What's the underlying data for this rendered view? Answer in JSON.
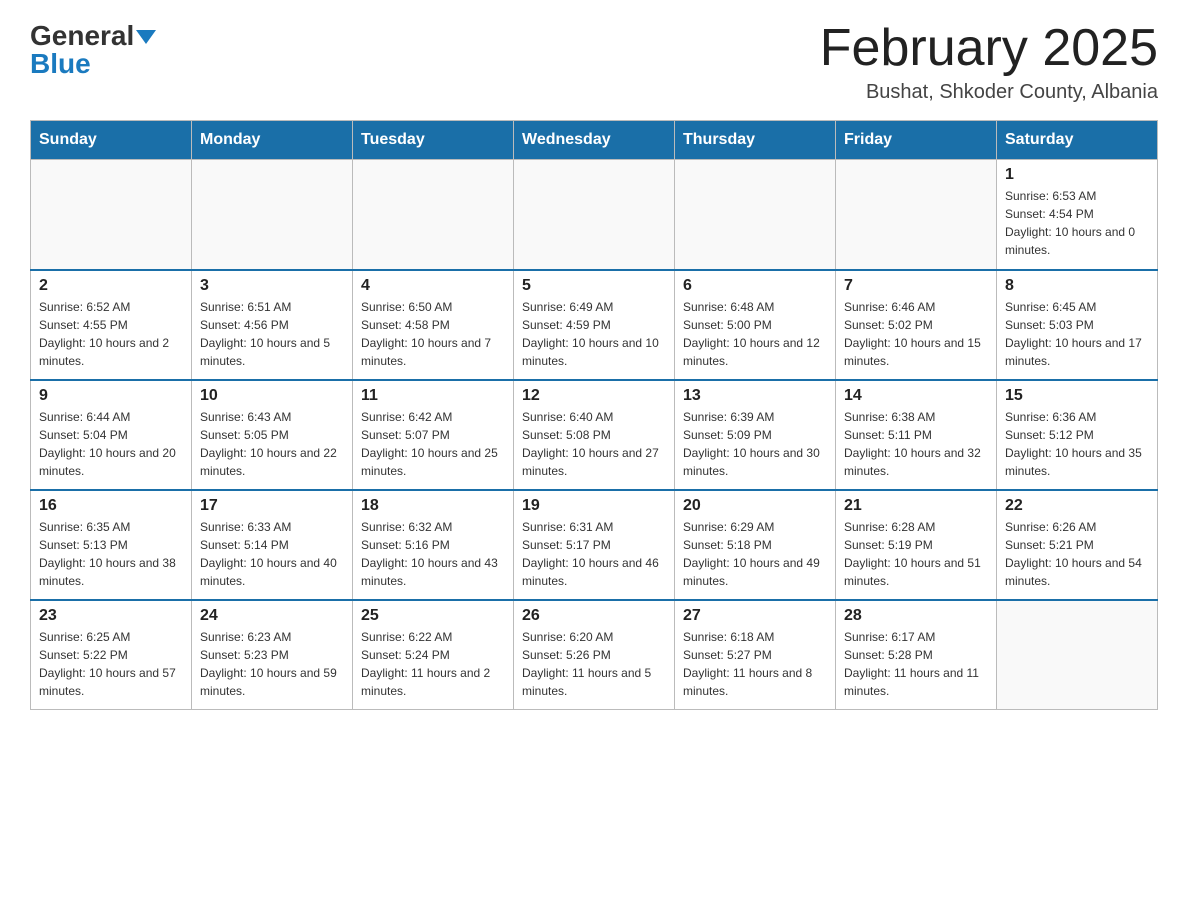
{
  "header": {
    "logo_general": "General",
    "logo_blue": "Blue",
    "month_title": "February 2025",
    "subtitle": "Bushat, Shkoder County, Albania"
  },
  "days_of_week": [
    "Sunday",
    "Monday",
    "Tuesday",
    "Wednesday",
    "Thursday",
    "Friday",
    "Saturday"
  ],
  "weeks": [
    [
      {
        "day": "",
        "info": ""
      },
      {
        "day": "",
        "info": ""
      },
      {
        "day": "",
        "info": ""
      },
      {
        "day": "",
        "info": ""
      },
      {
        "day": "",
        "info": ""
      },
      {
        "day": "",
        "info": ""
      },
      {
        "day": "1",
        "info": "Sunrise: 6:53 AM\nSunset: 4:54 PM\nDaylight: 10 hours and 0 minutes."
      }
    ],
    [
      {
        "day": "2",
        "info": "Sunrise: 6:52 AM\nSunset: 4:55 PM\nDaylight: 10 hours and 2 minutes."
      },
      {
        "day": "3",
        "info": "Sunrise: 6:51 AM\nSunset: 4:56 PM\nDaylight: 10 hours and 5 minutes."
      },
      {
        "day": "4",
        "info": "Sunrise: 6:50 AM\nSunset: 4:58 PM\nDaylight: 10 hours and 7 minutes."
      },
      {
        "day": "5",
        "info": "Sunrise: 6:49 AM\nSunset: 4:59 PM\nDaylight: 10 hours and 10 minutes."
      },
      {
        "day": "6",
        "info": "Sunrise: 6:48 AM\nSunset: 5:00 PM\nDaylight: 10 hours and 12 minutes."
      },
      {
        "day": "7",
        "info": "Sunrise: 6:46 AM\nSunset: 5:02 PM\nDaylight: 10 hours and 15 minutes."
      },
      {
        "day": "8",
        "info": "Sunrise: 6:45 AM\nSunset: 5:03 PM\nDaylight: 10 hours and 17 minutes."
      }
    ],
    [
      {
        "day": "9",
        "info": "Sunrise: 6:44 AM\nSunset: 5:04 PM\nDaylight: 10 hours and 20 minutes."
      },
      {
        "day": "10",
        "info": "Sunrise: 6:43 AM\nSunset: 5:05 PM\nDaylight: 10 hours and 22 minutes."
      },
      {
        "day": "11",
        "info": "Sunrise: 6:42 AM\nSunset: 5:07 PM\nDaylight: 10 hours and 25 minutes."
      },
      {
        "day": "12",
        "info": "Sunrise: 6:40 AM\nSunset: 5:08 PM\nDaylight: 10 hours and 27 minutes."
      },
      {
        "day": "13",
        "info": "Sunrise: 6:39 AM\nSunset: 5:09 PM\nDaylight: 10 hours and 30 minutes."
      },
      {
        "day": "14",
        "info": "Sunrise: 6:38 AM\nSunset: 5:11 PM\nDaylight: 10 hours and 32 minutes."
      },
      {
        "day": "15",
        "info": "Sunrise: 6:36 AM\nSunset: 5:12 PM\nDaylight: 10 hours and 35 minutes."
      }
    ],
    [
      {
        "day": "16",
        "info": "Sunrise: 6:35 AM\nSunset: 5:13 PM\nDaylight: 10 hours and 38 minutes."
      },
      {
        "day": "17",
        "info": "Sunrise: 6:33 AM\nSunset: 5:14 PM\nDaylight: 10 hours and 40 minutes."
      },
      {
        "day": "18",
        "info": "Sunrise: 6:32 AM\nSunset: 5:16 PM\nDaylight: 10 hours and 43 minutes."
      },
      {
        "day": "19",
        "info": "Sunrise: 6:31 AM\nSunset: 5:17 PM\nDaylight: 10 hours and 46 minutes."
      },
      {
        "day": "20",
        "info": "Sunrise: 6:29 AM\nSunset: 5:18 PM\nDaylight: 10 hours and 49 minutes."
      },
      {
        "day": "21",
        "info": "Sunrise: 6:28 AM\nSunset: 5:19 PM\nDaylight: 10 hours and 51 minutes."
      },
      {
        "day": "22",
        "info": "Sunrise: 6:26 AM\nSunset: 5:21 PM\nDaylight: 10 hours and 54 minutes."
      }
    ],
    [
      {
        "day": "23",
        "info": "Sunrise: 6:25 AM\nSunset: 5:22 PM\nDaylight: 10 hours and 57 minutes."
      },
      {
        "day": "24",
        "info": "Sunrise: 6:23 AM\nSunset: 5:23 PM\nDaylight: 10 hours and 59 minutes."
      },
      {
        "day": "25",
        "info": "Sunrise: 6:22 AM\nSunset: 5:24 PM\nDaylight: 11 hours and 2 minutes."
      },
      {
        "day": "26",
        "info": "Sunrise: 6:20 AM\nSunset: 5:26 PM\nDaylight: 11 hours and 5 minutes."
      },
      {
        "day": "27",
        "info": "Sunrise: 6:18 AM\nSunset: 5:27 PM\nDaylight: 11 hours and 8 minutes."
      },
      {
        "day": "28",
        "info": "Sunrise: 6:17 AM\nSunset: 5:28 PM\nDaylight: 11 hours and 11 minutes."
      },
      {
        "day": "",
        "info": ""
      }
    ]
  ]
}
